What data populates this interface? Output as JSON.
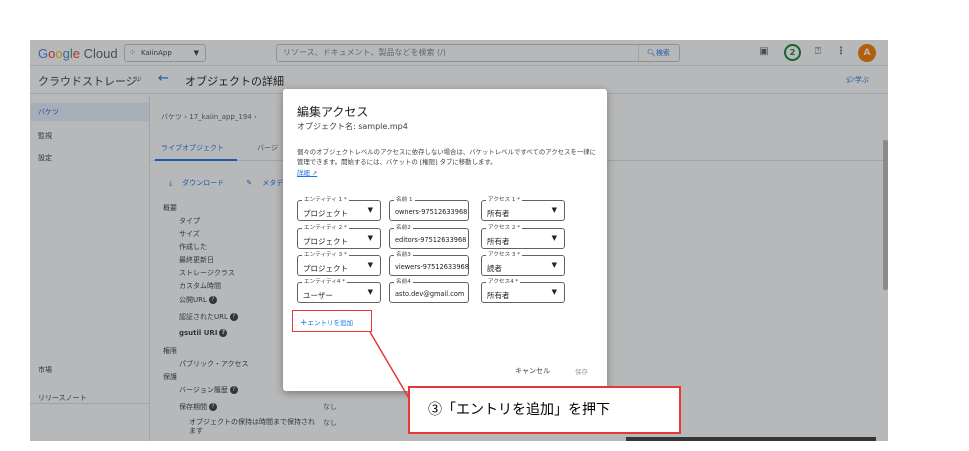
{
  "topbar": {
    "logo_google": [
      "G",
      "o",
      "o",
      "g",
      "l",
      "e"
    ],
    "logo_cloud": "Cloud",
    "project": "KaiinApp",
    "search_placeholder": "リソース、ドキュメント、製品などを検索 (/)",
    "search_button": "検索",
    "notifications_count": "2",
    "avatar_initial": "A",
    "icons": [
      "terminal-icon",
      "help-icon",
      "more-vert-icon"
    ]
  },
  "subbar": {
    "service_title": "クラウドストレージ",
    "page_title": "オブジェクトの詳細",
    "learn": "学ぶ"
  },
  "sidebar": {
    "items": [
      {
        "label": "バケツ",
        "active": true
      },
      {
        "label": "監視",
        "active": false
      },
      {
        "label": "設定",
        "active": false
      }
    ],
    "bottom_items": [
      {
        "label": "市場"
      },
      {
        "label": "リリースノート"
      }
    ]
  },
  "main": {
    "breadcrumb": "バケツ  ›  17_kaiin_app_194  ›",
    "tabs": [
      "ライブオブジェクト",
      "バージ"
    ],
    "actions": [
      "ダウンロード",
      "メタデー"
    ],
    "rows": [
      {
        "label": "概要",
        "value": ""
      },
      {
        "label": "タイプ",
        "value": ""
      },
      {
        "label": "サイズ",
        "value": ""
      },
      {
        "label": "作成した",
        "value": ""
      },
      {
        "label": "最終更新日",
        "value": ""
      },
      {
        "label": "ストレージクラス",
        "value": ""
      },
      {
        "label": "カスタム時間",
        "value": ""
      },
      {
        "label": "公開URL",
        "value": ""
      },
      {
        "label": "認証されたURL",
        "value": ""
      },
      {
        "label": "gsutil URI",
        "value": ""
      },
      {
        "label": "権限",
        "value": ""
      },
      {
        "label": "パブリック・アクセス",
        "value": ""
      },
      {
        "label": "保護",
        "value": ""
      },
      {
        "label": "バージョン履歴",
        "value": ""
      },
      {
        "label": "保存期間",
        "value": "なし"
      },
      {
        "label": "オブジェクトの保持は時間まで保持されます",
        "value": "なし"
      }
    ]
  },
  "dialog": {
    "title": "編集アクセス",
    "subtitle": "オブジェクト名: sample.mp4",
    "description": "個々のオブジェクトレベルのアクセスに依存しない場合は、バケットレベルですべてのアクセスを一律に管理できます。開始するには、バケットの [権限] タブに移動します。",
    "details_link": "詳細",
    "entries": [
      {
        "entity_label": "エンティティ 1 *",
        "entity": "プロジェクト",
        "name_label": "名前 1",
        "name": "owners-97512633968",
        "access_label": "アクセス 1 *",
        "access": "所有者"
      },
      {
        "entity_label": "エンティティ 2 *",
        "entity": "プロジェクト",
        "name_label": "名前2",
        "name": "editors-97512633968",
        "access_label": "アクセス 2 *",
        "access": "所有者"
      },
      {
        "entity_label": "エンティティ 3 *",
        "entity": "プロジェクト",
        "name_label": "名前3",
        "name": "viewers-97512633968",
        "access_label": "アクセス 3 *",
        "access": "読者"
      },
      {
        "entity_label": "エンティティ4 *",
        "entity": "ユーザー",
        "name_label": "名前4",
        "name": "asto.dev@gmail.com",
        "access_label": "アクセス4 *",
        "access": "所有者"
      }
    ],
    "add_entry": "エントリを追加",
    "cancel": "キャンセル",
    "save": "保存"
  },
  "annotation": {
    "text": "③「エントリを追加」を押下"
  },
  "colors": {
    "accent": "#1a73e8",
    "highlight": "#e53935"
  }
}
